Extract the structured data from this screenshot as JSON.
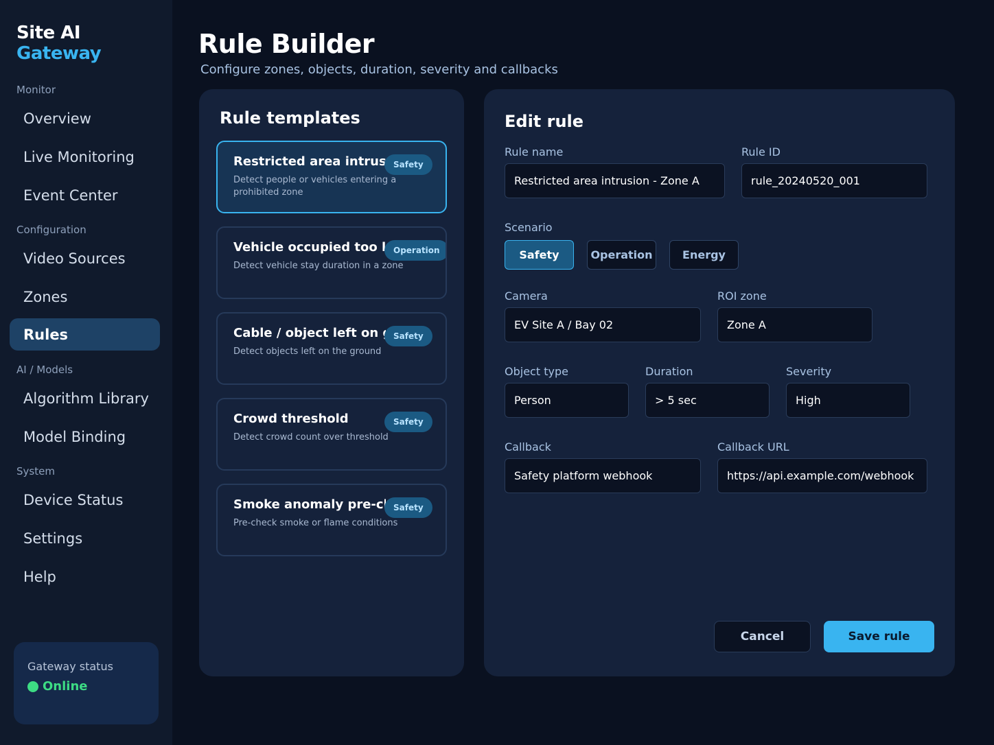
{
  "brand": {
    "line1": "Site AI",
    "line2": "Gateway"
  },
  "nav": {
    "sections": [
      "Monitor",
      "Configuration",
      "AI / Models",
      "System"
    ],
    "items": [
      {
        "label": "Overview"
      },
      {
        "label": "Live Monitoring"
      },
      {
        "label": "Event Center"
      },
      {
        "label": "Video Sources"
      },
      {
        "label": "Zones"
      },
      {
        "label": "Rules",
        "active": true
      },
      {
        "label": "Algorithm Library"
      },
      {
        "label": "Model Binding"
      },
      {
        "label": "Device Status"
      },
      {
        "label": "Settings"
      },
      {
        "label": "Help"
      }
    ]
  },
  "gateway_status": {
    "label": "Gateway status",
    "value": "Online",
    "color": "#3ddc84"
  },
  "header": {
    "title": "Rule Builder",
    "subtitle": "Configure zones, objects, duration, severity and callbacks"
  },
  "templates": {
    "title": "Rule templates",
    "items": [
      {
        "title": "Restricted area intrusion",
        "badge": "Safety",
        "desc": "Detect people or vehicles entering a prohibited zone",
        "selected": true
      },
      {
        "title": "Vehicle occupied too long",
        "badge": "Operation",
        "desc": "Detect vehicle stay duration in a zone"
      },
      {
        "title": "Cable / object left on ground",
        "badge": "Safety",
        "desc": "Detect objects left on the ground"
      },
      {
        "title": "Crowd threshold",
        "badge": "Safety",
        "desc": "Detect crowd count over threshold"
      },
      {
        "title": "Smoke anomaly pre-check",
        "badge": "Safety",
        "desc": "Pre-check smoke or flame conditions"
      }
    ]
  },
  "edit": {
    "title": "Edit rule",
    "rule_name": {
      "label": "Rule name",
      "value": "Restricted area intrusion - Zone A"
    },
    "rule_id": {
      "label": "Rule ID",
      "value": "rule_20240520_001"
    },
    "scenario": {
      "label": "Scenario",
      "options": [
        "Safety",
        "Operation",
        "Energy"
      ],
      "selected": "Safety"
    },
    "camera": {
      "label": "Camera",
      "value": "EV Site A / Bay 02"
    },
    "roi_zone": {
      "label": "ROI zone",
      "value": "Zone A"
    },
    "object_type": {
      "label": "Object type",
      "value": "Person"
    },
    "duration": {
      "label": "Duration",
      "value": "> 5 sec"
    },
    "severity": {
      "label": "Severity",
      "value": "High"
    },
    "callback": {
      "label": "Callback",
      "value": "Safety platform webhook"
    },
    "callback_url": {
      "label": "Callback URL",
      "value": "https://api.example.com/webhook"
    },
    "cancel_label": "Cancel",
    "save_label": "Save rule"
  },
  "colors": {
    "accent": "#39b4f0",
    "background": "#0a1120",
    "panel": "#15223b",
    "online": "#3ddc84"
  }
}
